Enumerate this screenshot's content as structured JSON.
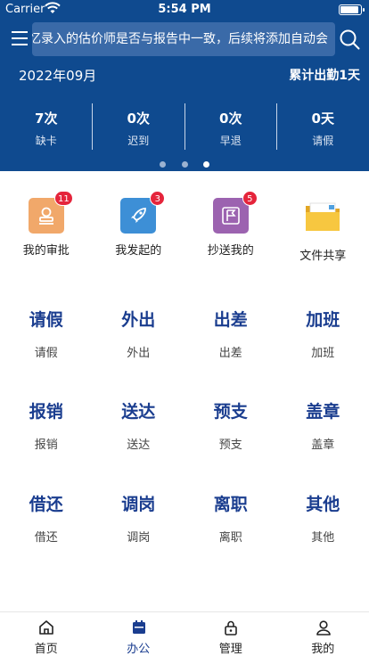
{
  "status_bar": {
    "carrier": "Carrier",
    "time": "5:54 PM"
  },
  "header": {
    "marquee_text": "忆录入的估价师是否与报告中一致，后续将添加自动会",
    "month": "2022年09月",
    "total_attendance": "累计出勤1天",
    "stats": [
      {
        "value": "7次",
        "label": "缺卡"
      },
      {
        "value": "0次",
        "label": "迟到"
      },
      {
        "value": "0次",
        "label": "早退"
      },
      {
        "value": "0天",
        "label": "请假"
      }
    ]
  },
  "quick_actions": [
    {
      "label": "我的审批",
      "badge": "11",
      "color": "#f1a86a",
      "icon": "stamp-icon"
    },
    {
      "label": "我发起的",
      "badge": "3",
      "color": "#3d8fd6",
      "icon": "rocket-icon"
    },
    {
      "label": "抄送我的",
      "badge": "5",
      "color": "#9c63b0",
      "icon": "flag-icon"
    },
    {
      "label": "文件共享",
      "badge": "",
      "color": "#f5c242",
      "icon": "folder-icon"
    }
  ],
  "grid": [
    {
      "big": "请假",
      "small": "请假"
    },
    {
      "big": "外出",
      "small": "外出"
    },
    {
      "big": "出差",
      "small": "出差"
    },
    {
      "big": "加班",
      "small": "加班"
    },
    {
      "big": "报销",
      "small": "报销"
    },
    {
      "big": "送达",
      "small": "送达"
    },
    {
      "big": "预支",
      "small": "预支"
    },
    {
      "big": "盖章",
      "small": "盖章"
    },
    {
      "big": "借还",
      "small": "借还"
    },
    {
      "big": "调岗",
      "small": "调岗"
    },
    {
      "big": "离职",
      "small": "离职"
    },
    {
      "big": "其他",
      "small": "其他"
    }
  ],
  "tabs": [
    {
      "label": "首页",
      "icon": "home-icon",
      "active": false
    },
    {
      "label": "办公",
      "icon": "calendar-icon",
      "active": true
    },
    {
      "label": "管理",
      "icon": "lock-icon",
      "active": false
    },
    {
      "label": "我的",
      "icon": "person-icon",
      "active": false
    }
  ],
  "colors": {
    "header_bg": "#0f4a8f",
    "accent": "#1a3d8f",
    "badge": "#e5243b"
  }
}
